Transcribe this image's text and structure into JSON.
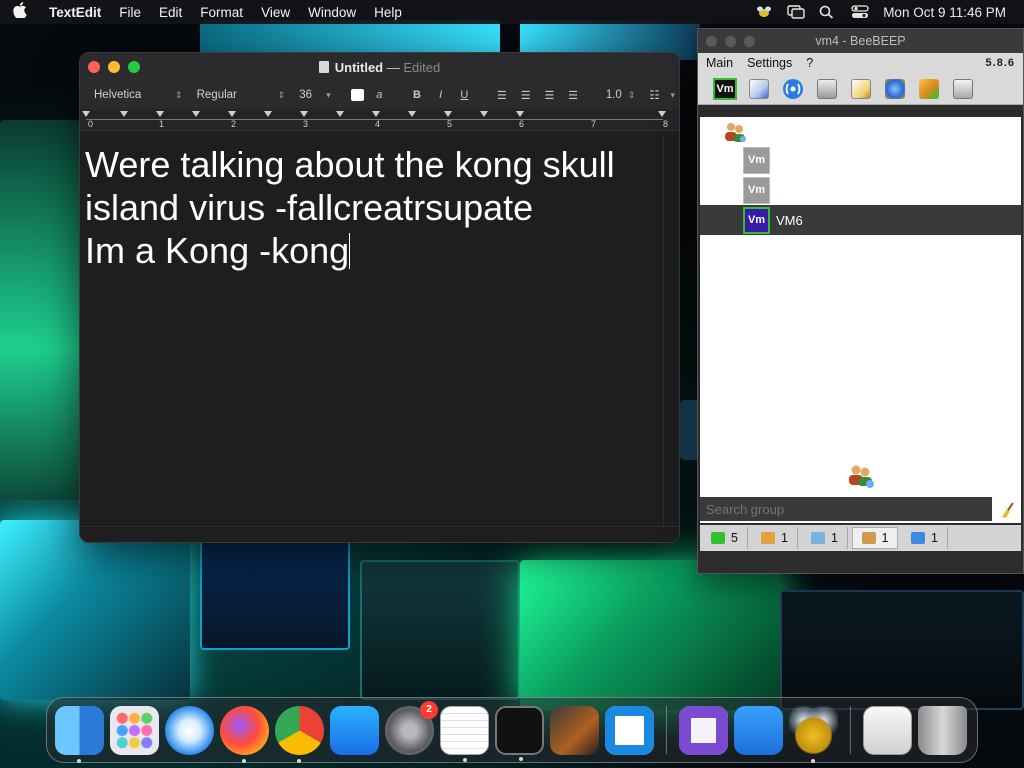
{
  "menubar": {
    "app_name": "TextEdit",
    "items": [
      "File",
      "Edit",
      "Format",
      "View",
      "Window",
      "Help"
    ],
    "clock": "Mon Oct 9  11:46 PM"
  },
  "textedit": {
    "title": "Untitled",
    "title_separator": "—",
    "status": "Edited",
    "toolbar": {
      "font_family": "Helvetica",
      "font_style": "Regular",
      "font_size": "36",
      "bold": "B",
      "italic": "I",
      "underline": "U",
      "line_spacing": "1.0"
    },
    "ruler_numbers": [
      "0",
      "1",
      "2",
      "3",
      "4",
      "5",
      "6",
      "7",
      "8"
    ],
    "lines": [
      "Were talking about the kong skull",
      "island virus -fallcreatrsupate",
      "",
      "Im a Kong -kong"
    ]
  },
  "beebeep": {
    "title": "vm4 - BeeBEEP",
    "menu": [
      "Main",
      "Settings",
      "?"
    ],
    "version": "5.8.6",
    "vm_toolbar_label": "Vm",
    "users": [
      {
        "badge": "Vm",
        "name": ""
      },
      {
        "badge": "Vm",
        "name": ""
      },
      {
        "badge": "Vm",
        "name": "VM6"
      }
    ],
    "search_placeholder": "Search group",
    "status_counts": [
      "5",
      "1",
      "1",
      "1",
      "1"
    ]
  },
  "dock": {
    "apps": [
      "Finder",
      "Launchpad",
      "Safari",
      "Firefox",
      "Chrome",
      "App Store",
      "System Settings",
      "TextEdit",
      "Terminal",
      "GarageBand",
      "Visual Studio Code",
      "Visual Studio",
      "Weather",
      "BeeBEEP",
      "Preview",
      "Trash"
    ],
    "system_settings_badge": "2"
  },
  "colors": {
    "accent_green": "#2fbf2f",
    "selected_vm": "#3a1aa8",
    "traffic_red": "#ff5f57",
    "traffic_yellow": "#febc2e",
    "traffic_green": "#28c840"
  }
}
